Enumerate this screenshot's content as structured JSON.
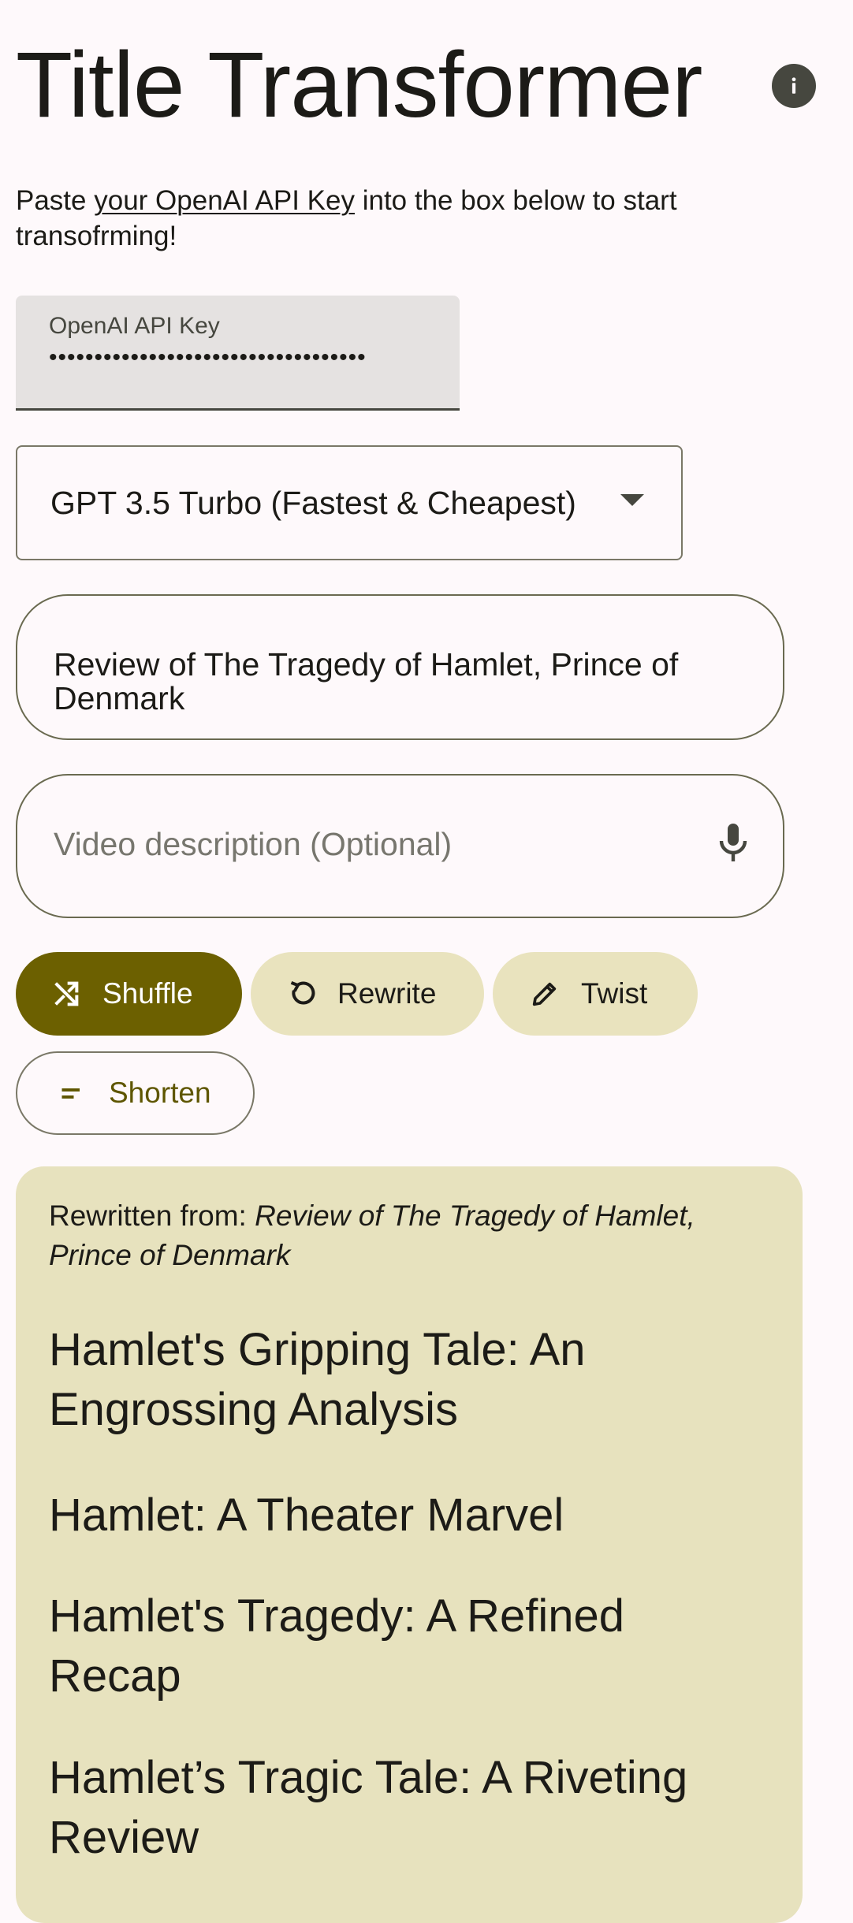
{
  "header": {
    "title": "Title Transformer",
    "info_icon": "info-icon"
  },
  "intro": {
    "prefix": "Paste ",
    "link_text": "your OpenAI API Key",
    "suffix": " into the box below to start transofrming!"
  },
  "api_key": {
    "label": "OpenAI API Key",
    "value": "•••••••••••••••••••••••••••••••••••"
  },
  "model_select": {
    "selected": "GPT 3.5 Turbo (Fastest & Cheapest)",
    "icon": "dropdown-arrow-icon"
  },
  "title_input": {
    "value": "Review of The Tragedy of Hamlet, Prince of Denmark"
  },
  "description_input": {
    "placeholder": "Video description (Optional)",
    "icon": "microphone-icon"
  },
  "actions": {
    "shuffle": "Shuffle",
    "rewrite": "Rewrite",
    "twist": "Twist",
    "shorten": "Shorten"
  },
  "results": {
    "source_prefix": "Rewritten from: ",
    "source_title": "Review of The Tragedy of Hamlet, Prince of Denmark",
    "titles": [
      "Hamlet's Gripping Tale: An Engrossing Analysis",
      "Hamlet: A Theater Marvel",
      "Hamlet's Tragedy: A Refined Recap",
      "Hamlet’s Tragic Tale: A Riveting Review"
    ]
  },
  "colors": {
    "background": "#FEF9FB",
    "primary": "#6C6000",
    "secondary_container": "#E9E3BE",
    "card": "#E7E2BE"
  }
}
